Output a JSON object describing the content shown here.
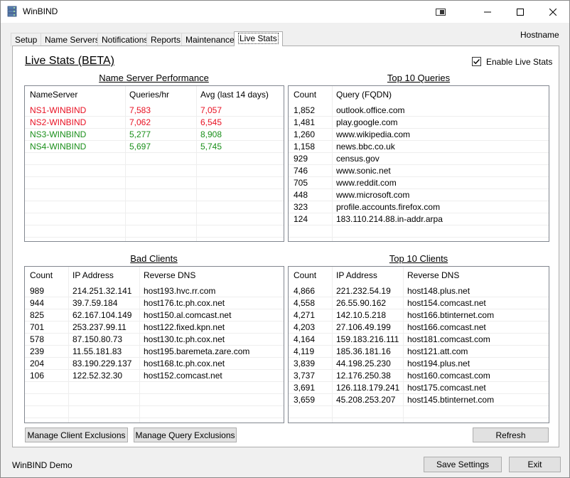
{
  "window": {
    "title": "WinBIND",
    "hostname": "Hostname",
    "status_text": "WinBIND Demo"
  },
  "tabs": [
    {
      "label": "Setup",
      "active": false
    },
    {
      "label": "Name Servers",
      "active": false
    },
    {
      "label": "Notifications",
      "active": false
    },
    {
      "label": "Reports",
      "active": false
    },
    {
      "label": "Maintenance",
      "active": false
    },
    {
      "label": "Live Stats",
      "active": true
    }
  ],
  "live_stats": {
    "title": "Live Stats (BETA)",
    "enable_label": "Enable Live Stats",
    "enable_checked": true
  },
  "name_server_performance": {
    "title": "Name Server Performance",
    "columns": [
      "NameServer",
      "Queries/hr",
      "Avg (last 14 days)"
    ],
    "rows": [
      {
        "cells": [
          "NS1-WINBIND",
          "7,583",
          "7,057"
        ],
        "status": "red"
      },
      {
        "cells": [
          "NS2-WINBIND",
          "7,062",
          "6,545"
        ],
        "status": "red"
      },
      {
        "cells": [
          "NS3-WINBIND",
          "5,277",
          "8,908"
        ],
        "status": "green"
      },
      {
        "cells": [
          "NS4-WINBIND",
          "5,697",
          "5,745"
        ],
        "status": "green"
      }
    ]
  },
  "top_queries": {
    "title": "Top 10 Queries",
    "columns": [
      "Count",
      "Query (FQDN)"
    ],
    "rows": [
      [
        "1,852",
        "outlook.office.com"
      ],
      [
        "1,481",
        "play.google.com"
      ],
      [
        "1,260",
        "www.wikipedia.com"
      ],
      [
        "1,158",
        "news.bbc.co.uk"
      ],
      [
        "929",
        "census.gov"
      ],
      [
        "746",
        "www.sonic.net"
      ],
      [
        "705",
        "www.reddit.com"
      ],
      [
        "448",
        "www.microsoft.com"
      ],
      [
        "323",
        "profile.accounts.firefox.com"
      ],
      [
        "124",
        "183.110.214.88.in-addr.arpa"
      ]
    ]
  },
  "bad_clients": {
    "title": "Bad Clients",
    "columns": [
      "Count",
      "IP Address",
      "Reverse DNS"
    ],
    "rows": [
      [
        "989",
        "214.251.32.141",
        "host193.hvc.rr.com"
      ],
      [
        "944",
        "39.7.59.184",
        "host176.tc.ph.cox.net"
      ],
      [
        "825",
        "62.167.104.149",
        "host150.al.comcast.net"
      ],
      [
        "701",
        "253.237.99.11",
        "host122.fixed.kpn.net"
      ],
      [
        "578",
        "87.150.80.73",
        "host130.tc.ph.cox.net"
      ],
      [
        "239",
        "11.55.181.83",
        "host195.baremeta.zare.com"
      ],
      [
        "204",
        "83.190.229.137",
        "host168.tc.ph.cox.net"
      ],
      [
        "106",
        "122.52.32.30",
        "host152.comcast.net"
      ]
    ]
  },
  "top_clients": {
    "title": "Top 10 Clients",
    "columns": [
      "Count",
      "IP Address",
      "Reverse DNS"
    ],
    "rows": [
      [
        "4,866",
        "221.232.54.19",
        "host148.plus.net"
      ],
      [
        "4,558",
        "26.55.90.162",
        "host154.comcast.net"
      ],
      [
        "4,271",
        "142.10.5.218",
        "host166.btinternet.com"
      ],
      [
        "4,203",
        "27.106.49.199",
        "host166.comcast.net"
      ],
      [
        "4,164",
        "159.183.216.111",
        "host181.comcast.com"
      ],
      [
        "4,119",
        "185.36.181.16",
        "host121.att.com"
      ],
      [
        "3,839",
        "44.198.25.230",
        "host194.plus.net"
      ],
      [
        "3,737",
        "12.176.250.38",
        "host160.comcast.com"
      ],
      [
        "3,691",
        "126.118.179.241",
        "host175.comcast.net"
      ],
      [
        "3,659",
        "45.208.253.207",
        "host145.btinternet.com"
      ]
    ]
  },
  "buttons": {
    "manage_client_exclusions": "Manage Client Exclusions",
    "manage_query_exclusions": "Manage Query Exclusions",
    "refresh": "Refresh",
    "save_settings": "Save Settings",
    "exit": "Exit"
  },
  "colors": {
    "bad": "#e81123",
    "good": "#1a8f1a"
  }
}
